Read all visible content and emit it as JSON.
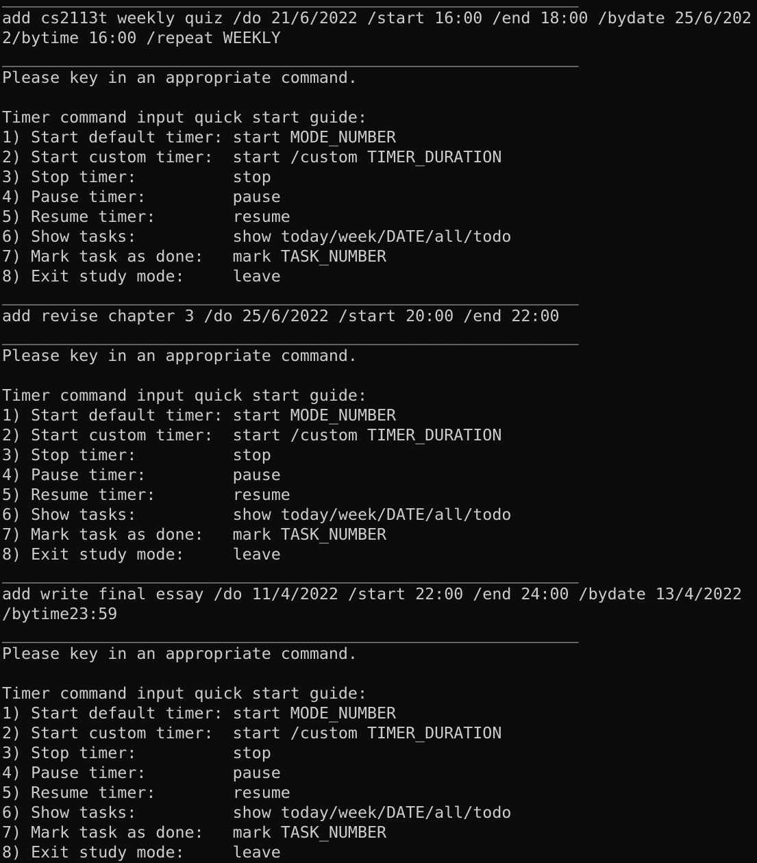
{
  "colors": {
    "background": "#0c0c0c",
    "foreground": "#cccccc"
  },
  "separator": "____________________________________________________________",
  "lines": [
    {
      "type": "separator"
    },
    {
      "type": "input",
      "text": "add cs2113t weekly quiz /do 21/6/2022 /start 16:00 /end 18:00 /bydate 25/6/202"
    },
    {
      "type": "input",
      "text": "2/bytime 16:00 /repeat WEEKLY"
    },
    {
      "type": "separator"
    },
    {
      "type": "output",
      "text": "Please key in an appropriate command."
    },
    {
      "type": "blank",
      "text": ""
    },
    {
      "type": "output",
      "text": "Timer command input quick start guide:"
    },
    {
      "type": "output",
      "text": "1) Start default timer: start MODE_NUMBER"
    },
    {
      "type": "output",
      "text": "2) Start custom timer:  start /custom TIMER_DURATION"
    },
    {
      "type": "output",
      "text": "3) Stop timer:          stop"
    },
    {
      "type": "output",
      "text": "4) Pause timer:         pause"
    },
    {
      "type": "output",
      "text": "5) Resume timer:        resume"
    },
    {
      "type": "output",
      "text": "6) Show tasks:          show today/week/DATE/all/todo"
    },
    {
      "type": "output",
      "text": "7) Mark task as done:   mark TASK_NUMBER"
    },
    {
      "type": "output",
      "text": "8) Exit study mode:     leave"
    },
    {
      "type": "separator"
    },
    {
      "type": "input",
      "text": "add revise chapter 3 /do 25/6/2022 /start 20:00 /end 22:00"
    },
    {
      "type": "separator"
    },
    {
      "type": "output",
      "text": "Please key in an appropriate command."
    },
    {
      "type": "blank",
      "text": ""
    },
    {
      "type": "output",
      "text": "Timer command input quick start guide:"
    },
    {
      "type": "output",
      "text": "1) Start default timer: start MODE_NUMBER"
    },
    {
      "type": "output",
      "text": "2) Start custom timer:  start /custom TIMER_DURATION"
    },
    {
      "type": "output",
      "text": "3) Stop timer:          stop"
    },
    {
      "type": "output",
      "text": "4) Pause timer:         pause"
    },
    {
      "type": "output",
      "text": "5) Resume timer:        resume"
    },
    {
      "type": "output",
      "text": "6) Show tasks:          show today/week/DATE/all/todo"
    },
    {
      "type": "output",
      "text": "7) Mark task as done:   mark TASK_NUMBER"
    },
    {
      "type": "output",
      "text": "8) Exit study mode:     leave"
    },
    {
      "type": "separator"
    },
    {
      "type": "input",
      "text": "add write final essay /do 11/4/2022 /start 22:00 /end 24:00 /bydate 13/4/2022"
    },
    {
      "type": "input",
      "text": "/bytime23:59"
    },
    {
      "type": "separator"
    },
    {
      "type": "output",
      "text": "Please key in an appropriate command."
    },
    {
      "type": "blank",
      "text": ""
    },
    {
      "type": "output",
      "text": "Timer command input quick start guide:"
    },
    {
      "type": "output",
      "text": "1) Start default timer: start MODE_NUMBER"
    },
    {
      "type": "output",
      "text": "2) Start custom timer:  start /custom TIMER_DURATION"
    },
    {
      "type": "output",
      "text": "3) Stop timer:          stop"
    },
    {
      "type": "output",
      "text": "4) Pause timer:         pause"
    },
    {
      "type": "output",
      "text": "5) Resume timer:        resume"
    },
    {
      "type": "output",
      "text": "6) Show tasks:          show today/week/DATE/all/todo"
    },
    {
      "type": "output",
      "text": "7) Mark task as done:   mark TASK_NUMBER"
    },
    {
      "type": "output",
      "text": "8) Exit study mode:     leave"
    }
  ]
}
